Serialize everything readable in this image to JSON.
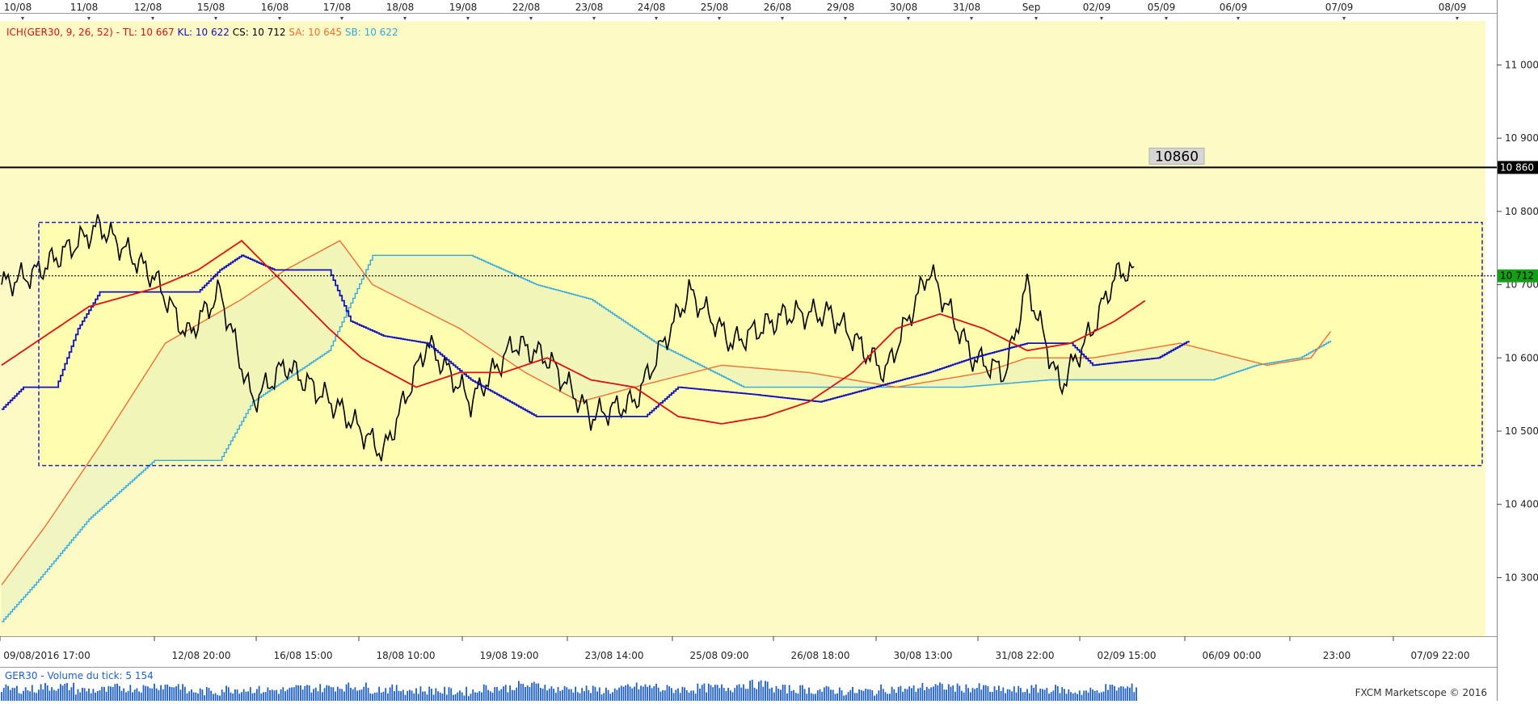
{
  "top_dates": [
    "10/08",
    "11/08",
    "12/08",
    "15/08",
    "16/08",
    "17/08",
    "18/08",
    "19/08",
    "22/08",
    "23/08",
    "24/08",
    "25/08",
    "26/08",
    "29/08",
    "30/08",
    "31/08",
    "Sep",
    "02/09",
    "05/09",
    "06/09",
    "07/09",
    "08/09"
  ],
  "bottom_times": [
    "09/08/2016 17:00",
    "12/08 20:00",
    "16/08 15:00",
    "18/08 10:00",
    "19/08 19:00",
    "23/08 14:00",
    "25/08 09:00",
    "26/08 18:00",
    "30/08 13:00",
    "31/08 22:00",
    "02/09 15:00",
    "06/09 00:00",
    "23:00",
    "07/09 22:00"
  ],
  "indicator_legend": [
    {
      "text": "ICH(GER30, 9, 26, 52) -  TL: 10 667",
      "color": "#e01010"
    },
    {
      "text": "KL: 10 622",
      "color": "#1010c0"
    },
    {
      "text": "CS: 10 712",
      "color": "#000000"
    },
    {
      "text": "SA: 10 645",
      "color": "#f07030"
    },
    {
      "text": "SB: 10 622",
      "color": "#30a8e0"
    }
  ],
  "volume_legend": "GER30 - Volume du tick: 5 154",
  "watermark": "FXCM Marketscope © 2016",
  "level_label": "10860",
  "price_tags": {
    "level": "10 860",
    "last": "10 712"
  },
  "colors": {
    "plot_bg": "#fefac6",
    "bull_candle": "#1f5fc8",
    "bear_candle": "#e01010",
    "tenkan": "#e01010",
    "kijun": "#1010c0",
    "chikou": "#000000",
    "senkou_a": "#f07030",
    "senkou_b": "#30a8e0",
    "range_box": "#2020c0",
    "last_tag_bg": "#14a014"
  },
  "chart_data": {
    "type": "candlestick",
    "instrument": "GER30",
    "ylim": [
      10220,
      11060
    ],
    "y_ticks": [
      10300,
      10400,
      10500,
      10600,
      10700,
      10800,
      10900,
      11000
    ],
    "y_tick_labels": [
      "10 300",
      "10 400",
      "10 500",
      "10 600",
      "10 700",
      "10 800",
      "10 900",
      "11 000"
    ],
    "horizontal_level": 10860,
    "last_price": 10712,
    "range_box": {
      "top": 10785,
      "bottom": 10453
    },
    "ohlc_anchors": [
      {
        "i": 0,
        "c": 10690
      },
      {
        "i": 20,
        "c": 10695
      },
      {
        "i": 45,
        "c": 10690
      },
      {
        "i": 60,
        "c": 10700
      },
      {
        "i": 78,
        "c": 10690
      },
      {
        "i": 90,
        "c": 10712
      },
      {
        "i": 95,
        "c": 10765
      },
      {
        "i": 110,
        "c": 10740
      },
      {
        "i": 130,
        "c": 10700
      },
      {
        "i": 150,
        "c": 10690
      },
      {
        "i": 168,
        "c": 10560
      },
      {
        "i": 185,
        "c": 10540
      },
      {
        "i": 200,
        "c": 10590
      },
      {
        "i": 215,
        "c": 10560
      },
      {
        "i": 230,
        "c": 10530
      },
      {
        "i": 250,
        "c": 10630
      },
      {
        "i": 270,
        "c": 10600
      },
      {
        "i": 290,
        "c": 10520
      },
      {
        "i": 300,
        "c": 10540
      },
      {
        "i": 320,
        "c": 10500
      },
      {
        "i": 345,
        "c": 10515
      },
      {
        "i": 360,
        "c": 10490
      },
      {
        "i": 375,
        "c": 10560
      },
      {
        "i": 395,
        "c": 10670
      },
      {
        "i": 420,
        "c": 10660
      },
      {
        "i": 440,
        "c": 10640
      },
      {
        "i": 455,
        "c": 10590
      },
      {
        "i": 470,
        "c": 10530
      },
      {
        "i": 490,
        "c": 10580
      },
      {
        "i": 510,
        "c": 10700
      },
      {
        "i": 520,
        "c": 10740
      }
    ],
    "tenkan_anchors": [
      [
        0,
        10590
      ],
      [
        40,
        10670
      ],
      [
        70,
        10695
      ],
      [
        90,
        10720
      ],
      [
        110,
        10760
      ],
      [
        130,
        10700
      ],
      [
        150,
        10640
      ],
      [
        165,
        10600
      ],
      [
        190,
        10560
      ],
      [
        210,
        10580
      ],
      [
        230,
        10580
      ],
      [
        250,
        10600
      ],
      [
        270,
        10570
      ],
      [
        290,
        10560
      ],
      [
        310,
        10520
      ],
      [
        330,
        10510
      ],
      [
        350,
        10520
      ],
      [
        370,
        10540
      ],
      [
        390,
        10580
      ],
      [
        410,
        10640
      ],
      [
        430,
        10660
      ],
      [
        450,
        10640
      ],
      [
        470,
        10610
      ],
      [
        490,
        10620
      ],
      [
        510,
        10650
      ],
      [
        525,
        10680
      ]
    ],
    "kijun_anchors": [
      [
        0,
        10530
      ],
      [
        10,
        10560
      ],
      [
        25,
        10560
      ],
      [
        35,
        10640
      ],
      [
        45,
        10690
      ],
      [
        90,
        10690
      ],
      [
        100,
        10720
      ],
      [
        110,
        10740
      ],
      [
        125,
        10720
      ],
      [
        150,
        10720
      ],
      [
        160,
        10650
      ],
      [
        175,
        10630
      ],
      [
        195,
        10620
      ],
      [
        215,
        10570
      ],
      [
        245,
        10520
      ],
      [
        265,
        10520
      ],
      [
        295,
        10520
      ],
      [
        310,
        10560
      ],
      [
        345,
        10550
      ],
      [
        375,
        10540
      ],
      [
        400,
        10560
      ],
      [
        425,
        10580
      ],
      [
        445,
        10600
      ],
      [
        470,
        10620
      ],
      [
        490,
        10620
      ],
      [
        500,
        10590
      ],
      [
        530,
        10600
      ],
      [
        545,
        10625
      ]
    ],
    "senkou_a_anchors": [
      [
        0,
        10290
      ],
      [
        20,
        10370
      ],
      [
        45,
        10480
      ],
      [
        75,
        10620
      ],
      [
        110,
        10680
      ],
      [
        130,
        10720
      ],
      [
        155,
        10760
      ],
      [
        170,
        10700
      ],
      [
        210,
        10640
      ],
      [
        240,
        10580
      ],
      [
        265,
        10540
      ],
      [
        290,
        10560
      ],
      [
        330,
        10590
      ],
      [
        370,
        10580
      ],
      [
        410,
        10560
      ],
      [
        450,
        10580
      ],
      [
        470,
        10600
      ],
      [
        500,
        10600
      ],
      [
        540,
        10620
      ],
      [
        580,
        10590
      ],
      [
        600,
        10600
      ],
      [
        610,
        10640
      ]
    ],
    "senkou_b_anchors": [
      [
        0,
        10240
      ],
      [
        15,
        10290
      ],
      [
        40,
        10380
      ],
      [
        70,
        10460
      ],
      [
        100,
        10460
      ],
      [
        115,
        10540
      ],
      [
        150,
        10610
      ],
      [
        170,
        10740
      ],
      [
        215,
        10740
      ],
      [
        245,
        10700
      ],
      [
        270,
        10680
      ],
      [
        300,
        10620
      ],
      [
        340,
        10560
      ],
      [
        400,
        10560
      ],
      [
        440,
        10560
      ],
      [
        480,
        10570
      ],
      [
        520,
        10570
      ],
      [
        555,
        10570
      ],
      [
        575,
        10590
      ],
      [
        595,
        10600
      ],
      [
        610,
        10625
      ]
    ],
    "chikou_anchors": [
      [
        0,
        10700
      ],
      [
        15,
        10715
      ],
      [
        45,
        10780
      ],
      [
        70,
        10710
      ],
      [
        85,
        10630
      ],
      [
        100,
        10690
      ],
      [
        115,
        10540
      ],
      [
        130,
        10590
      ],
      [
        155,
        10530
      ],
      [
        175,
        10470
      ],
      [
        195,
        10620
      ],
      [
        215,
        10540
      ],
      [
        235,
        10620
      ],
      [
        250,
        10600
      ],
      [
        270,
        10520
      ],
      [
        290,
        10540
      ],
      [
        315,
        10690
      ],
      [
        335,
        10620
      ],
      [
        360,
        10660
      ],
      [
        380,
        10660
      ],
      [
        405,
        10580
      ],
      [
        425,
        10720
      ],
      [
        445,
        10600
      ],
      [
        460,
        10580
      ],
      [
        470,
        10700
      ],
      [
        485,
        10560
      ],
      [
        500,
        10640
      ],
      [
        510,
        10710
      ],
      [
        515,
        10720
      ],
      [
        520,
        10712
      ]
    ],
    "volume_anchors": [
      0.6,
      0.8,
      0.5,
      0.7,
      0.9,
      0.4,
      0.6,
      0.5,
      0.7,
      0.8,
      0.6,
      0.5,
      0.4,
      0.7,
      0.9,
      0.6,
      0.5,
      0.8,
      0.6,
      0.7,
      1.0,
      0.6,
      0.5,
      0.4,
      0.6,
      0.8,
      0.7,
      0.5,
      0.6,
      0.4,
      0.7,
      0.9
    ]
  }
}
